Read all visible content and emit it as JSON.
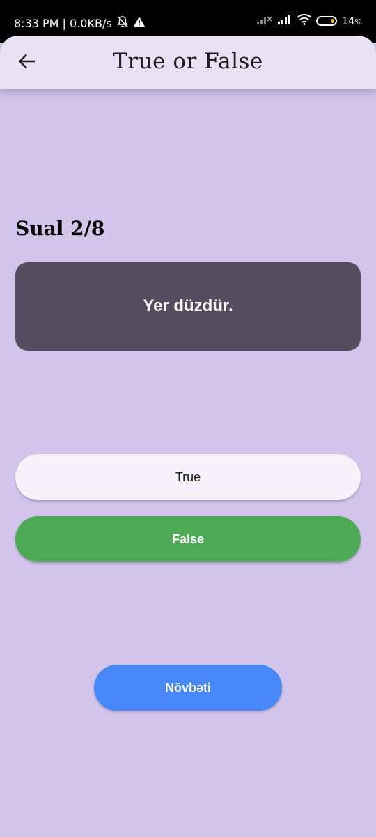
{
  "status_bar": {
    "time_speed": "8:33 PM | 0.0KB/s",
    "battery": "14",
    "battery_unit": "%",
    "icons": [
      "bell-off-icon",
      "alert-icon",
      "signal-x-icon",
      "signal-icon",
      "wifi-icon",
      "battery-icon"
    ]
  },
  "app_bar": {
    "title": "True or False",
    "back_icon": "arrow-left-icon"
  },
  "quiz": {
    "counter": "Sual 2/8",
    "question": "Yer düzdür.",
    "answers": {
      "true_label": "True",
      "false_label": "False"
    },
    "next_label": "Növbəti"
  },
  "colors": {
    "background": "#d1c5ea",
    "app_bar": "#e8e1f1",
    "question_card": "#544d5d",
    "true_button": "#f5f3f9",
    "false_button_selected": "#4eaa55",
    "next_button": "#4688f7"
  }
}
